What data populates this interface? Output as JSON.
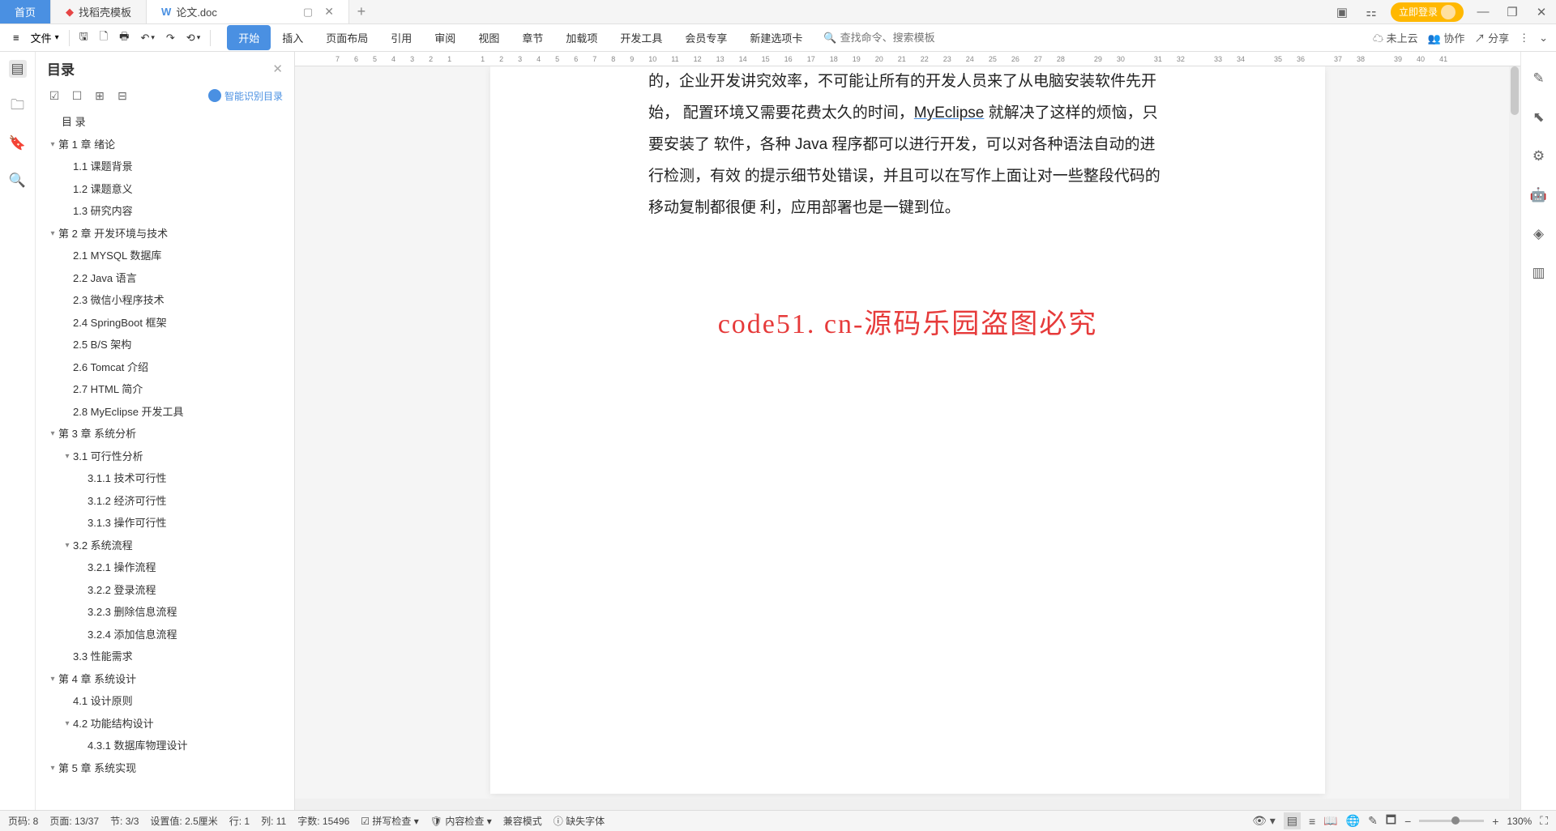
{
  "tabs": {
    "home": "首页",
    "tab1": "找稻壳模板",
    "tab2": "论文.doc"
  },
  "login_button": "立即登录",
  "file_menu": "文件",
  "menu": {
    "start": "开始",
    "insert": "插入",
    "layout": "页面布局",
    "reference": "引用",
    "review": "审阅",
    "view": "视图",
    "chapter": "章节",
    "addin": "加载项",
    "devtools": "开发工具",
    "member": "会员专享",
    "newtab": "新建选项卡"
  },
  "search_placeholder": "查找命令、搜索模板",
  "toolbar_right": {
    "cloud": "未上云",
    "collab": "协作",
    "share": "分享"
  },
  "ruler": [
    "7",
    "6",
    "5",
    "4",
    "3",
    "2",
    "1",
    "",
    "1",
    "2",
    "3",
    "4",
    "5",
    "6",
    "7",
    "8",
    "9",
    "10",
    "11",
    "12",
    "13",
    "14",
    "15",
    "16",
    "17",
    "18",
    "19",
    "20",
    "21",
    "22",
    "23",
    "24",
    "25",
    "26",
    "27",
    "28",
    "",
    "29",
    "30",
    "",
    "31",
    "32",
    "",
    "33",
    "34",
    "",
    "35",
    "36",
    "",
    "37",
    "38",
    "",
    "39",
    "40",
    "41"
  ],
  "outline": {
    "title": "目录",
    "smart_toc": "智能识别目录",
    "muluLabel": "目  录",
    "items": [
      {
        "indent": 0,
        "chev": true,
        "label": "第 1 章  绪论"
      },
      {
        "indent": 1,
        "chev": false,
        "label": "1.1  课题背景"
      },
      {
        "indent": 1,
        "chev": false,
        "label": "1.2  课题意义"
      },
      {
        "indent": 1,
        "chev": false,
        "label": "1.3  研究内容"
      },
      {
        "indent": 0,
        "chev": true,
        "label": "第 2 章  开发环境与技术"
      },
      {
        "indent": 1,
        "chev": false,
        "label": "2.1  MYSQL 数据库"
      },
      {
        "indent": 1,
        "chev": false,
        "label": "2.2  Java 语言"
      },
      {
        "indent": 1,
        "chev": false,
        "label": "2.3  微信小程序技术"
      },
      {
        "indent": 1,
        "chev": false,
        "label": "2.4  SpringBoot 框架"
      },
      {
        "indent": 1,
        "chev": false,
        "label": "2.5  B/S 架构"
      },
      {
        "indent": 1,
        "chev": false,
        "label": "2.6  Tomcat  介绍"
      },
      {
        "indent": 1,
        "chev": false,
        "label": "2.7  HTML 简介"
      },
      {
        "indent": 1,
        "chev": false,
        "label": "2.8  MyEclipse 开发工具"
      },
      {
        "indent": 0,
        "chev": true,
        "label": "第 3 章  系统分析"
      },
      {
        "indent": 1,
        "chev": true,
        "label": "3.1  可行性分析"
      },
      {
        "indent": 2,
        "chev": false,
        "label": "3.1.1  技术可行性"
      },
      {
        "indent": 2,
        "chev": false,
        "label": "3.1.2  经济可行性"
      },
      {
        "indent": 2,
        "chev": false,
        "label": "3.1.3  操作可行性"
      },
      {
        "indent": 1,
        "chev": true,
        "label": "3.2  系统流程"
      },
      {
        "indent": 2,
        "chev": false,
        "label": "3.2.1  操作流程"
      },
      {
        "indent": 2,
        "chev": false,
        "label": "3.2.2  登录流程"
      },
      {
        "indent": 2,
        "chev": false,
        "label": "3.2.3  删除信息流程"
      },
      {
        "indent": 2,
        "chev": false,
        "label": "3.2.4  添加信息流程"
      },
      {
        "indent": 1,
        "chev": false,
        "label": "3.3  性能需求"
      },
      {
        "indent": 0,
        "chev": true,
        "label": "第 4 章  系统设计"
      },
      {
        "indent": 1,
        "chev": false,
        "label": "4.1  设计原则"
      },
      {
        "indent": 1,
        "chev": true,
        "label": "4.2  功能结构设计"
      },
      {
        "indent": 2,
        "chev": false,
        "label": "4.3.1  数据库物理设计"
      },
      {
        "indent": 0,
        "chev": true,
        "label": "第 5 章  系统实现"
      }
    ]
  },
  "document": {
    "line1_prefix": "的，企业开发讲究效率，不可能让所有的开发人员来了从电脑安装软件先开始，",
    "line2_prefix": "配置环境又需要花费太久的时间，",
    "myeclipse": "MyEclipse",
    "line2_suffix": " 就解决了这样的烦恼，只要安装了",
    "line3": "软件，各种 Java 程序都可以进行开发，可以对各种语法自动的进行检测，有效",
    "line4": "的提示细节处错误，并且可以在写作上面让对一些整段代码的移动复制都很便",
    "line5": "利，应用部署也是一键到位。",
    "watermark": "code51. cn-源码乐园盗图必究"
  },
  "statusbar": {
    "page_num": "页码: 8",
    "page": "页面: 13/37",
    "section": "节: 3/3",
    "setting": "设置值: 2.5厘米",
    "row": "行: 1",
    "col": "列: 11",
    "words": "字数: 15496",
    "spell": "拼写检查",
    "content": "内容检查",
    "compat": "兼容模式",
    "font": "缺失字体",
    "zoom": "130%"
  }
}
